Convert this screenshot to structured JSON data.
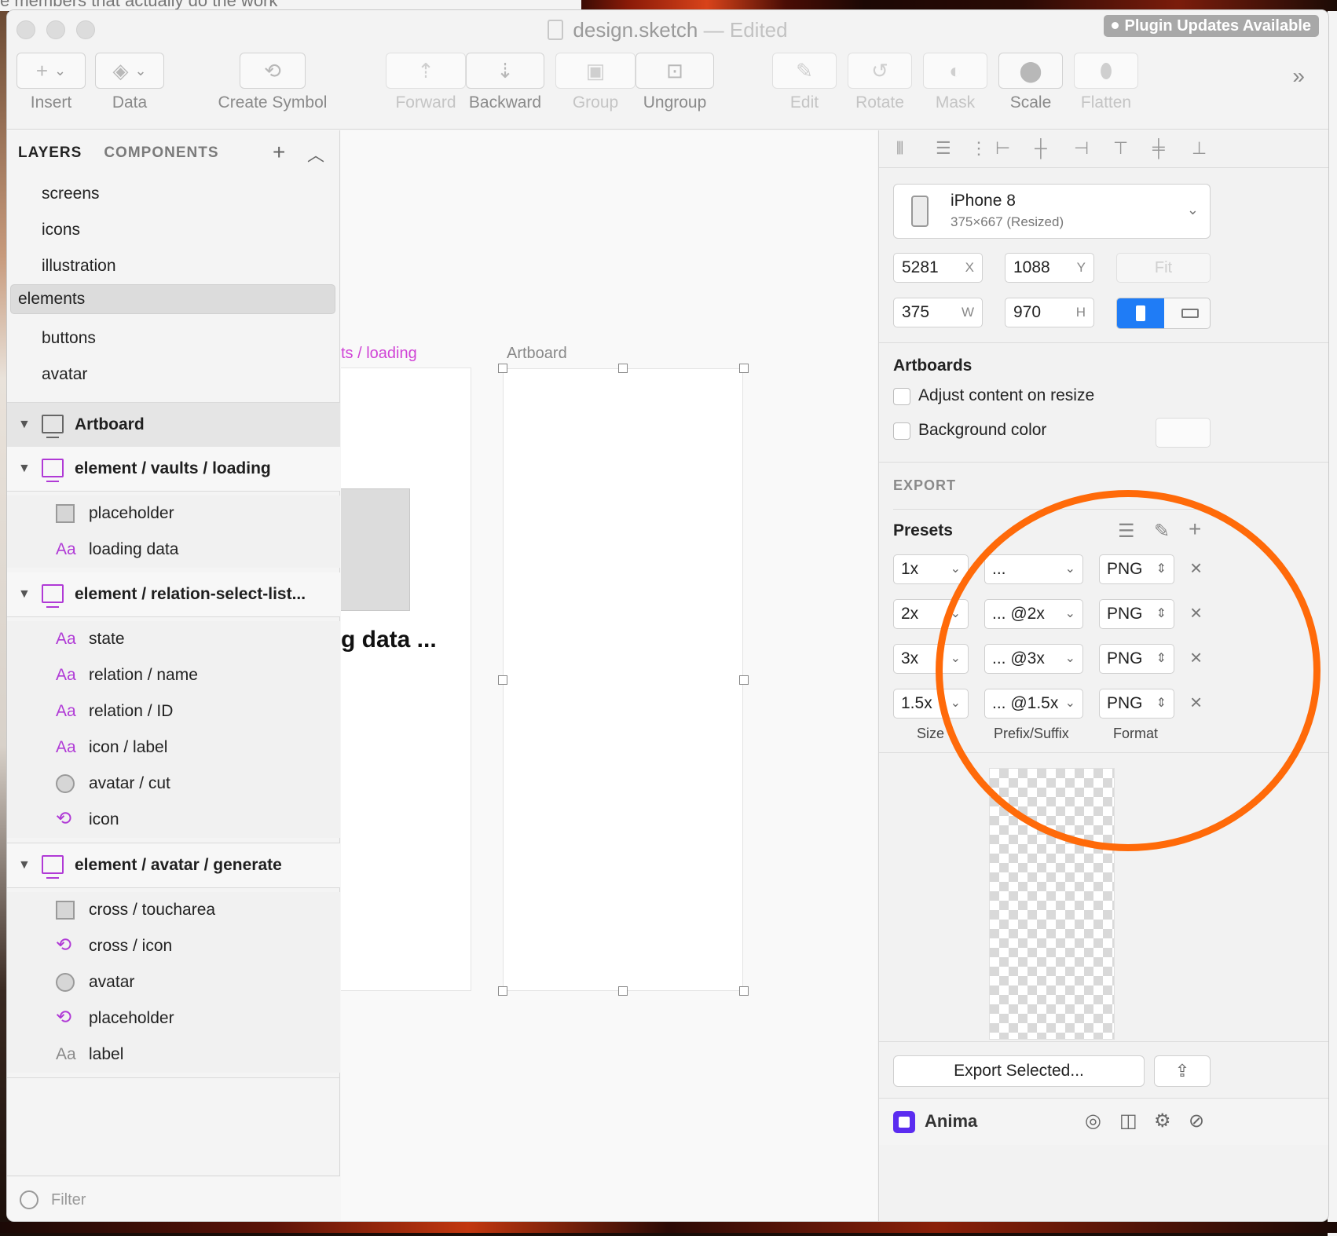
{
  "background": {
    "partial_text": "e members that actually do the work"
  },
  "window": {
    "title": "design.sketch",
    "title_sep": "—",
    "title_status": "Edited",
    "plugin_badge": "Plugin Updates Available"
  },
  "toolbar": {
    "insert_label": "Insert",
    "data_label": "Data",
    "create_symbol_label": "Create Symbol",
    "forward_label": "Forward",
    "backward_label": "Backward",
    "group_label": "Group",
    "ungroup_label": "Ungroup",
    "edit_label": "Edit",
    "rotate_label": "Rotate",
    "mask_label": "Mask",
    "scale_label": "Scale",
    "flatten_label": "Flatten"
  },
  "sidebar": {
    "tab_layers": "LAYERS",
    "tab_components": "COMPONENTS",
    "pages": [
      "screens",
      "icons",
      "illustration",
      "elements",
      "buttons",
      "avatar"
    ],
    "selected_page": "elements",
    "artboard_group": "Artboard",
    "groups": [
      {
        "name": "element / vaults / loading",
        "children": [
          {
            "icon": "rect",
            "label": "placeholder"
          },
          {
            "icon": "text",
            "label": "loading data"
          }
        ]
      },
      {
        "name": "element / relation-select-list...",
        "children": [
          {
            "icon": "text",
            "label": "state"
          },
          {
            "icon": "text",
            "label": "relation / name"
          },
          {
            "icon": "text",
            "label": "relation / ID"
          },
          {
            "icon": "text",
            "label": "icon / label"
          },
          {
            "icon": "oval",
            "label": "avatar / cut"
          },
          {
            "icon": "symbol",
            "label": "icon"
          }
        ]
      },
      {
        "name": "element / avatar / generate",
        "children": [
          {
            "icon": "rect",
            "label": "cross / toucharea"
          },
          {
            "icon": "symbol",
            "label": "cross / icon"
          },
          {
            "icon": "oval",
            "label": "avatar"
          },
          {
            "icon": "symbol",
            "label": "placeholder"
          },
          {
            "icon": "text-grey",
            "label": "label"
          }
        ]
      }
    ],
    "filter_placeholder": "Filter"
  },
  "canvas": {
    "artboard1_label": "ts / loading",
    "artboard1_text": "g data ...",
    "artboard2_label": "Artboard"
  },
  "inspector": {
    "device_name": "iPhone 8",
    "device_size": "375×667 (Resized)",
    "x": "5281",
    "x_label": "X",
    "y": "1088",
    "y_label": "Y",
    "w": "375",
    "w_label": "W",
    "h": "970",
    "h_label": "H",
    "fit_label": "Fit",
    "artboards_title": "Artboards",
    "adjust_label": "Adjust content on resize",
    "bgcolor_label": "Background color",
    "export_title": "EXPORT",
    "presets_label": "Presets",
    "export_rows": [
      {
        "size": "1x",
        "suffix": "...",
        "format": "PNG"
      },
      {
        "size": "2x",
        "suffix": "... @2x",
        "format": "PNG"
      },
      {
        "size": "3x",
        "suffix": "... @3x",
        "format": "PNG"
      },
      {
        "size": "1.5x",
        "suffix": "... @1.5x",
        "format": "PNG"
      }
    ],
    "col_size": "Size",
    "col_prefix": "Prefix/Suffix",
    "col_format": "Format",
    "export_button": "Export Selected...",
    "plugin_name": "Anima"
  },
  "colors": {
    "accent": "#1f7cf6",
    "symbol": "#b03ad6",
    "annotation": "#ff6a09",
    "anima": "#5b2cf0"
  }
}
